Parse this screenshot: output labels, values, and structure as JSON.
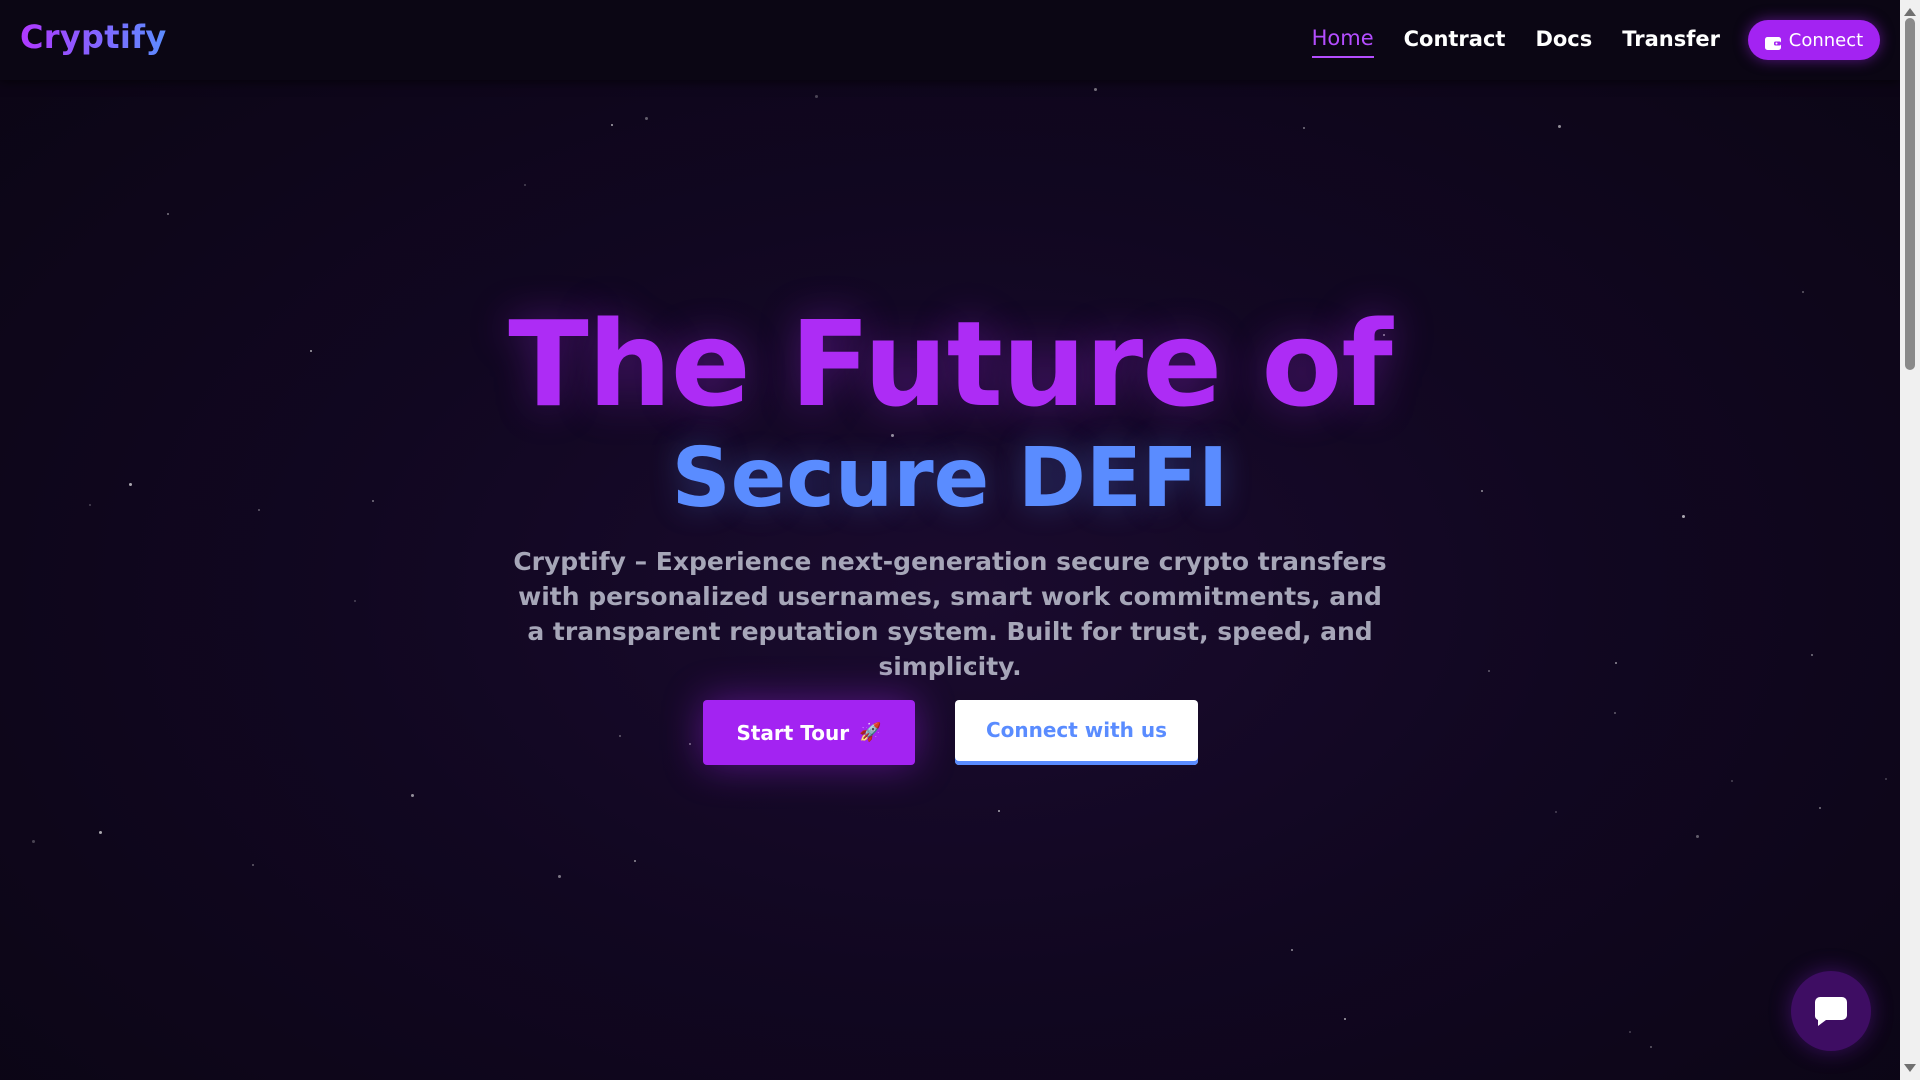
{
  "navbar": {
    "logo": "Cryptify",
    "links": [
      {
        "label": "Home",
        "active": true
      },
      {
        "label": "Contract",
        "active": false
      },
      {
        "label": "Docs",
        "active": false
      },
      {
        "label": "Transfer",
        "active": false
      }
    ],
    "connect_label": "Connect",
    "connect_icon": "wallet-icon"
  },
  "hero": {
    "title_line1": "The Future of",
    "title_line2": "Secure DEFI",
    "subtitle": "Cryptify – Experience next-generation secure crypto transfers with personalized usernames, smart work commitments, and a transparent reputation system. Built for trust, speed, and simplicity.",
    "primary_button": "Start Tour",
    "primary_button_icon": "🚀",
    "secondary_button": "Connect with us"
  },
  "chat": {
    "icon": "chat-bubble-icon"
  },
  "colors": {
    "accent_purple": "#a323f2",
    "accent_blue": "#5a8cff",
    "background": "#0d0618",
    "subtitle_text": "#a6a6b8"
  }
}
